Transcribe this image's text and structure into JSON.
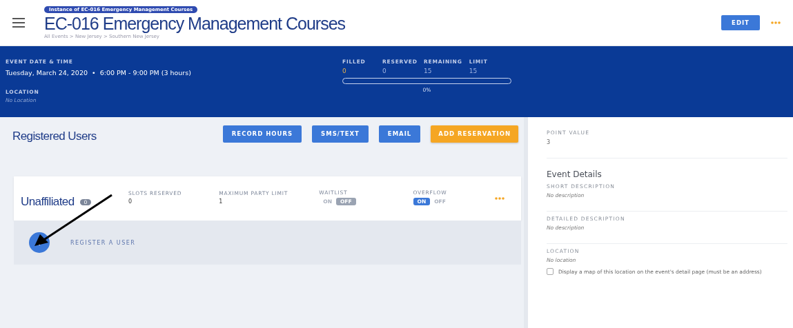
{
  "header": {
    "badge": "Instance of EC-016 Emergency Management Courses",
    "title": "EC-016 Emergency Management Courses",
    "breadcrumb": "All Events > New Jersey > Southern New Jersey",
    "edit_button": "EDIT"
  },
  "event_band": {
    "date_label": "EVENT DATE & TIME",
    "date_value": "Tuesday, March 24, 2020  •  6:00 PM - 9:00 PM (3 hours)",
    "location_label": "LOCATION",
    "location_value": "No Location",
    "stats": [
      {
        "label": "FILLED",
        "value": "0",
        "highlight": true
      },
      {
        "label": "RESERVED",
        "value": "0",
        "highlight": false
      },
      {
        "label": "REMAINING",
        "value": "15",
        "highlight": false
      },
      {
        "label": "LIMIT",
        "value": "15",
        "highlight": false
      }
    ],
    "progress": {
      "level": 0,
      "reading": "0%"
    }
  },
  "registered": {
    "title": "Registered Users",
    "buttons": [
      {
        "label": "RECORD HOURS",
        "kind": "primary"
      },
      {
        "label": "SMS/TEXT",
        "kind": "primary"
      },
      {
        "label": "EMAIL",
        "kind": "primary"
      },
      {
        "label": "ADD RESERVATION",
        "kind": "accent"
      }
    ],
    "group": {
      "name": "Unaffiliated",
      "count": "0",
      "fields": [
        {
          "kind": "text",
          "label": "SLOTS RESERVED",
          "value": "0"
        },
        {
          "kind": "text",
          "label": "MAXIMUM PARTY LIMIT",
          "value": "1"
        },
        {
          "kind": "toggle",
          "label": "WAITLIST",
          "options": [
            {
              "label": "ON",
              "selected": false
            },
            {
              "label": "OFF",
              "selected": true
            }
          ]
        },
        {
          "kind": "toggle",
          "label": "OVERFLOW",
          "options": [
            {
              "label": "ON",
              "selected": true
            },
            {
              "label": "OFF",
              "selected": false
            }
          ]
        }
      ]
    },
    "register_link": "REGISTER A USER"
  },
  "sidebar": {
    "point_label": "POINT VALUE",
    "point_value": "3",
    "details_title": "Event Details",
    "fields": [
      {
        "label": "SHORT DESCRIPTION",
        "value": "No description"
      },
      {
        "label": "DETAILED DESCRIPTION",
        "value": "No description"
      },
      {
        "label": "LOCATION",
        "value": "No location"
      }
    ],
    "map_option": {
      "label": "Display a map of this location on the event's detail page (must be an address)",
      "checked": false
    }
  }
}
